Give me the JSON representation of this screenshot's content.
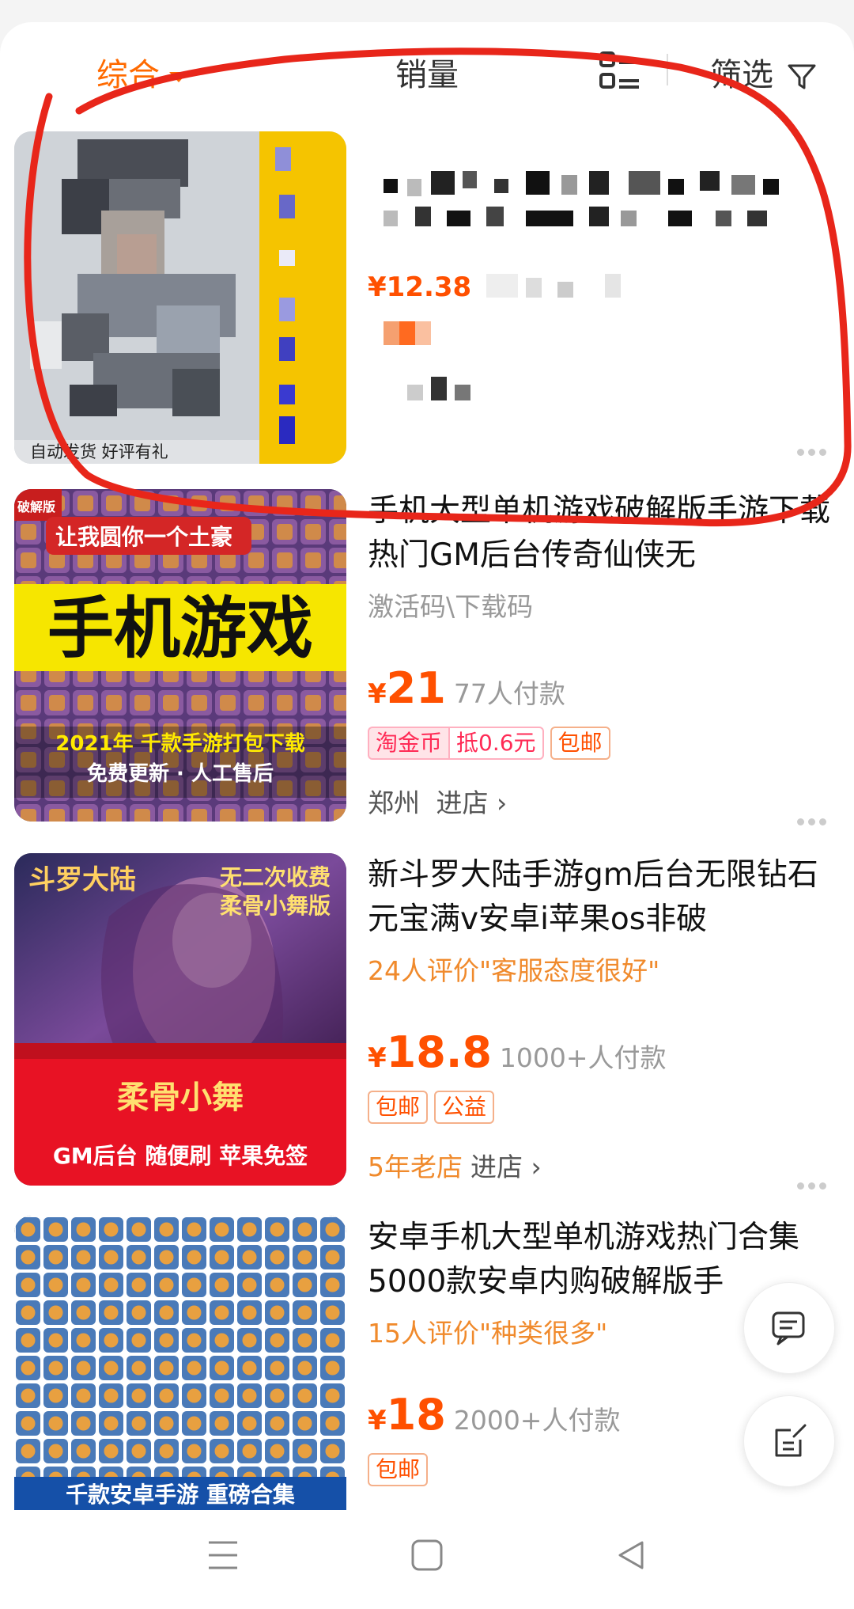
{
  "sortbar": {
    "comprehensive": "综合",
    "sales": "销量",
    "filter": "筛选"
  },
  "products": [
    {
      "thumb_caption": "自动发货  好评有礼",
      "price_yen": "¥",
      "price_visible": "12.38"
    },
    {
      "thumb_badge": "破解版",
      "thumb_line1": "让我圆你一个土豪",
      "thumb_main": "手机游戏",
      "thumb_line2": "2021年 千款手游打包下载",
      "thumb_line3": "免费更新 · 人工售后",
      "title": "手机大型单机游戏破解版手游下载热门GM后台传奇仙侠无",
      "sub": "激活码\\下载码",
      "price_yen": "¥",
      "price": "21",
      "paid": "77人付款",
      "tags": [
        "淘金币",
        "抵0.6元",
        "包邮"
      ],
      "shop": "郑州",
      "enter": "进店 ›"
    },
    {
      "thumb_logo": "斗罗大陆",
      "thumb_top1": "无二次收费",
      "thumb_top2": "柔骨小舞版",
      "thumb_banner": "柔骨小舞",
      "thumb_bottom": "GM后台  随便刷  苹果免签",
      "title": "新斗罗大陆手游gm后台无限钻石元宝满v安卓i苹果os非破",
      "sub": "24人评价\"客服态度很好\"",
      "price_yen": "¥",
      "price": "18.8",
      "paid": "1000+人付款",
      "tags": [
        "包邮",
        "公益"
      ],
      "shop_tag": "5年老店",
      "enter": "进店 ›"
    },
    {
      "thumb_bottom": "千款安卓手游 重磅合集",
      "title": "安卓手机大型单机游戏热门合集5000款安卓内购破解版手",
      "sub": "15人评价\"种类很多\"",
      "price_yen": "¥",
      "price": "18",
      "paid": "2000+人付款",
      "tags": [
        "包邮"
      ]
    }
  ],
  "colors": {
    "accent": "#ff6a00",
    "price": "#ff5000",
    "annotation": "#e8261a"
  }
}
